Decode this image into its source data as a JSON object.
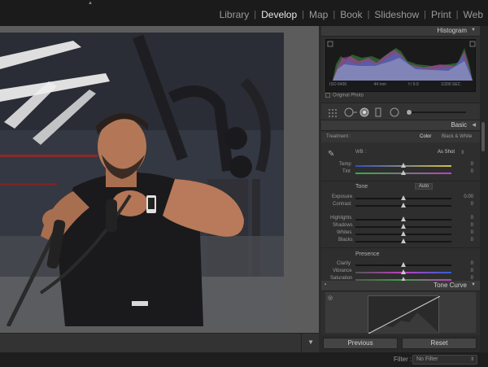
{
  "modules": [
    "Library",
    "Develop",
    "Map",
    "Book",
    "Slideshow",
    "Print",
    "Web"
  ],
  "active_module": "Develop",
  "panels": {
    "histogram": "Histogram",
    "basic": "Basic",
    "tone_curve": "Tone Curve"
  },
  "histogram_info": {
    "iso": "ISO 6400",
    "focal": "44 mm",
    "aperture": "f / 9.0",
    "shutter": "1/200 SEC"
  },
  "original_photo": "Original Photo",
  "treatment": {
    "label": "Treatment :",
    "color": "Color",
    "bw": "Black & White"
  },
  "wb": {
    "label": "WB :",
    "value": "As Shot"
  },
  "sliders_wb": [
    {
      "label": "Temp",
      "value": "0",
      "pos": 0.5
    },
    {
      "label": "Tint",
      "value": "0",
      "pos": 0.5
    }
  ],
  "tone": {
    "title": "Tone",
    "auto": "Auto"
  },
  "sliders_tone": [
    {
      "label": "Exposure",
      "value": "0.00",
      "pos": 0.5
    },
    {
      "label": "Contrast",
      "value": "0",
      "pos": 0.5
    }
  ],
  "sliders_tone2": [
    {
      "label": "Highlights",
      "value": "0",
      "pos": 0.5
    },
    {
      "label": "Shadows",
      "value": "0",
      "pos": 0.5
    },
    {
      "label": "Whites",
      "value": "0",
      "pos": 0.5
    },
    {
      "label": "Blacks",
      "value": "0",
      "pos": 0.5
    }
  ],
  "presence": {
    "title": "Presence"
  },
  "sliders_presence": [
    {
      "label": "Clarity",
      "value": "0",
      "pos": 0.5
    },
    {
      "label": "Vibrance",
      "value": "0",
      "pos": 0.5
    },
    {
      "label": "Saturation",
      "value": "0",
      "pos": 0.5
    }
  ],
  "buttons": {
    "previous": "Previous",
    "reset": "Reset"
  },
  "filter": {
    "label": "Filter :",
    "value": "No Filter"
  },
  "colors": {
    "accent_active": "#e8e8e8",
    "panel_bg": "#2e2e2e",
    "topbar_bg": "#1b1b1b"
  }
}
